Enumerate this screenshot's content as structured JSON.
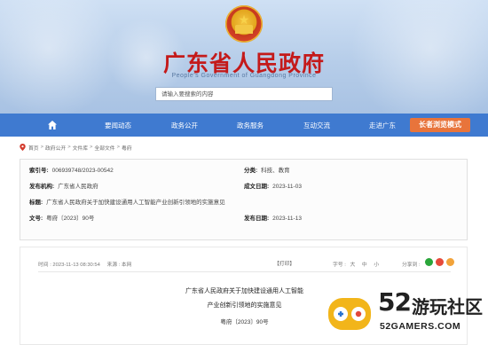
{
  "header": {
    "title": "广东省人民政府",
    "subtitle": "People's Government of Guangdong Province",
    "search_placeholder": "请输入要搜索的内容"
  },
  "nav": {
    "items": [
      "要闻动态",
      "政务公开",
      "政务服务",
      "互动交流",
      "走进广东"
    ],
    "elder_mode": "长者浏览模式",
    "accent": "#3f7ad0",
    "elder_color": "#e8743b"
  },
  "breadcrumb": {
    "items": [
      "首页",
      "政府公开",
      "文件库",
      "全部文件",
      "粤府"
    ],
    "separator": ">"
  },
  "info": {
    "index_no_label": "索引号:",
    "index_no": "006939748/2023-00542",
    "category_label": "分类:",
    "category": "科技、教育",
    "publisher_label": "发布机构:",
    "publisher": "广东省人民政府",
    "written_date_label": "成文日期:",
    "written_date": "2023-11-03",
    "title_label": "标题:",
    "title": "广东省人民政府关于加快建设通用人工智能产业创新引领地的实施意见",
    "doc_no_label": "文号:",
    "doc_no": "粤府〔2023〕90号",
    "publish_date_label": "发布日期:",
    "publish_date": "2023-11-13"
  },
  "doc": {
    "time": "时间 : 2023-11-13 08:30:54",
    "source": "来源 : 本网",
    "print": "【打印】",
    "font_size_label": "字号 :",
    "font_large": "大",
    "font_medium": "中",
    "font_small": "小",
    "share_label": "分享到 :",
    "title_line1": "广东省人民政府关于加快建设通用人工智能",
    "title_line2": "产业创新引领地的实施意见",
    "code": "粤府〔2023〕90号"
  },
  "watermark": {
    "number": "52",
    "name": "游玩社区",
    "domain": "52GAMERS.COM"
  }
}
